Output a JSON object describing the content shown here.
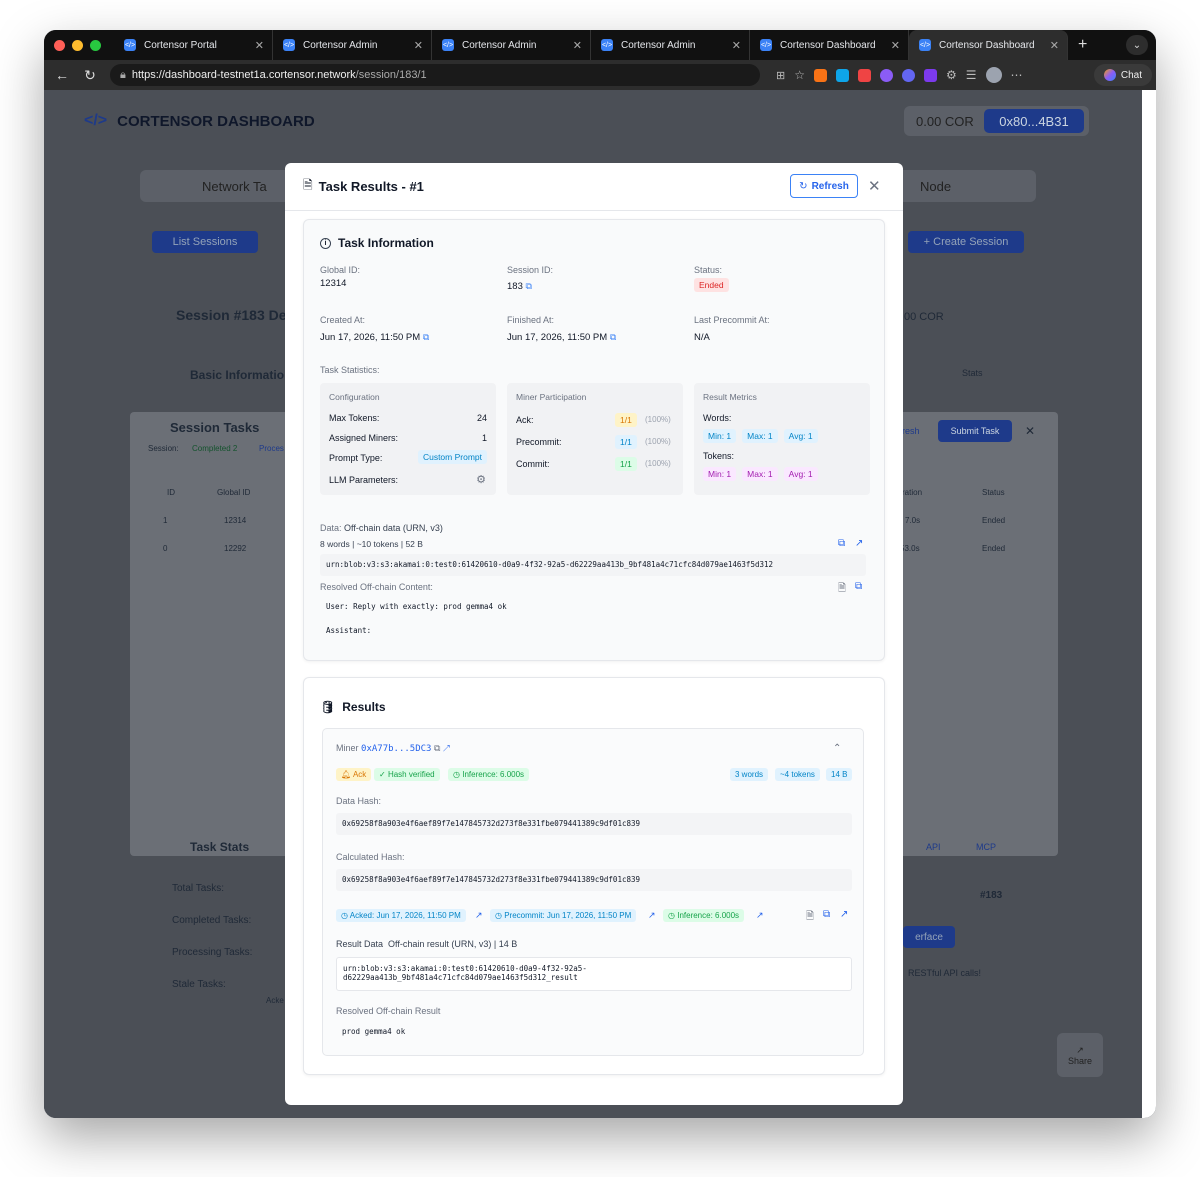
{
  "browser": {
    "tabs": [
      {
        "label": "Cortensor Portal",
        "active": false
      },
      {
        "label": "Cortensor Admin",
        "active": false
      },
      {
        "label": "Cortensor Admin",
        "active": false
      },
      {
        "label": "Cortensor Admin",
        "active": false
      },
      {
        "label": "Cortensor Dashboard",
        "active": false
      },
      {
        "label": "Cortensor Dashboard",
        "active": true
      }
    ],
    "url_host": "https://dashboard-testnet1a.cortensor.network",
    "url_path": "/session/183/1",
    "chat_label": "Chat"
  },
  "background": {
    "logo_text": "CORTENSOR DASHBOARD",
    "balance": "0.00 COR",
    "wallet": "0x80...4B31",
    "nav_left": "Network Ta",
    "nav_right": "Node",
    "list_sessions": "List Sessions",
    "create_session": "+ Create Session",
    "session_heading": "Session #183 De",
    "cor_small": "00 COR",
    "basic_info": "Basic Informatio",
    "stats_btn": "Stats",
    "task_stats": "Task Stats",
    "api": "API",
    "mcp": "MCP",
    "total_tasks": "Total Tasks:",
    "completed_tasks": "Completed Tasks:",
    "processing_tasks": "Processing Tasks:",
    "stale_tasks": "Stale Tasks:",
    "ack_short": "Acke",
    "session_num": "#183",
    "interface_btn": "erface",
    "restful": "RESTful API calls!",
    "share": "Share",
    "session_tasks": {
      "title": "Session Tasks",
      "session_label": "Session:",
      "completed_badge": "Completed 2",
      "processing_badge": "Proces",
      "refresh": "resh",
      "submit": "Submit Task",
      "columns": [
        "ID",
        "Global ID",
        "ration",
        "Status"
      ],
      "rows": [
        {
          "id": "1",
          "global": "12314",
          "duration": "7.0s",
          "status": "Ended"
        },
        {
          "id": "0",
          "global": "12292",
          "duration": "53.0s",
          "status": "Ended"
        }
      ]
    }
  },
  "modal": {
    "title": "Task Results - #1",
    "refresh": "Refresh",
    "info": {
      "title": "Task Information",
      "global_id_label": "Global ID:",
      "global_id": "12314",
      "session_id_label": "Session ID:",
      "session_id": "183",
      "status_label": "Status:",
      "status": "Ended",
      "created_label": "Created At:",
      "created": "Jun 17, 2026, 11:50 PM",
      "finished_label": "Finished At:",
      "finished": "Jun 17, 2026, 11:50 PM",
      "precommit_label": "Last Precommit At:",
      "precommit": "N/A",
      "stats_label": "Task Statistics:",
      "config": {
        "title": "Configuration",
        "max_tokens_label": "Max Tokens:",
        "max_tokens": "24",
        "assigned_label": "Assigned Miners:",
        "assigned": "1",
        "prompt_label": "Prompt Type:",
        "prompt": "Custom Prompt",
        "llm_label": "LLM Parameters:"
      },
      "participation": {
        "title": "Miner Participation",
        "ack_label": "Ack:",
        "ack": "1/1",
        "ack_pct": "(100%)",
        "precommit_label": "Precommit:",
        "precommit": "1/1",
        "precommit_pct": "(100%)",
        "commit_label": "Commit:",
        "commit": "1/1",
        "commit_pct": "(100%)"
      },
      "metrics": {
        "title": "Result Metrics",
        "words_label": "Words:",
        "words": [
          "Min: 1",
          "Max: 1",
          "Avg: 1"
        ],
        "tokens_label": "Tokens:",
        "tokens": [
          "Min: 1",
          "Max: 1",
          "Avg: 1"
        ]
      },
      "data_label": "Data:",
      "data_desc": "Off-chain data (URN, v3)",
      "data_meta": "8 words | ~10 tokens | 52 B",
      "data_urn": "urn:blob:v3:s3:akamai:0:test0:61420610-d0a9-4f32-92a5-d62229aa413b_9bf481a4c71cfc84d079ae1463f5d312",
      "resolved_label": "Resolved Off-chain Content:",
      "resolved_user": "User: Reply with exactly: prod gemma4 ok",
      "resolved_assistant": "Assistant:"
    },
    "results": {
      "title": "Results",
      "miner_label": "Miner",
      "miner_addr": "0xA77b...5DC3",
      "ack": "Ack",
      "hash_verified": "Hash verified",
      "inference": "Inference: 6.000s",
      "words": "3 words",
      "tokens": "~4 tokens",
      "bytes": "14 B",
      "data_hash_label": "Data Hash:",
      "data_hash": "0x69258f8a903e4f6aef89f7e147845732d273f8e331fbe079441389c9df01c839",
      "calc_hash_label": "Calculated Hash:",
      "calc_hash": "0x69258f8a903e4f6aef89f7e147845732d273f8e331fbe079441389c9df01c839",
      "acked": "Acked: Jun 17, 2026, 11:50 PM",
      "precommit": "Precommit: Jun 17, 2026, 11:50 PM",
      "inference2": "Inference: 6.000s",
      "result_data_label": "Result Data",
      "result_data_desc": "Off-chain result (URN, v3) | 14 B",
      "result_urn_1": "urn:blob:v3:s3:akamai:0:test0:61420610-d0a9-4f32-92a5-",
      "result_urn_2": "d62229aa413b_9bf481a4c71cfc84d079ae1463f5d312_result",
      "resolved_result_label": "Resolved Off-chain Result",
      "resolved_result": "prod gemma4 ok"
    }
  },
  "colors": {
    "accent": "#2563eb",
    "navy": "#1e3a8a",
    "ended_bg": "#fee2e2",
    "ended_fg": "#dc2626"
  }
}
